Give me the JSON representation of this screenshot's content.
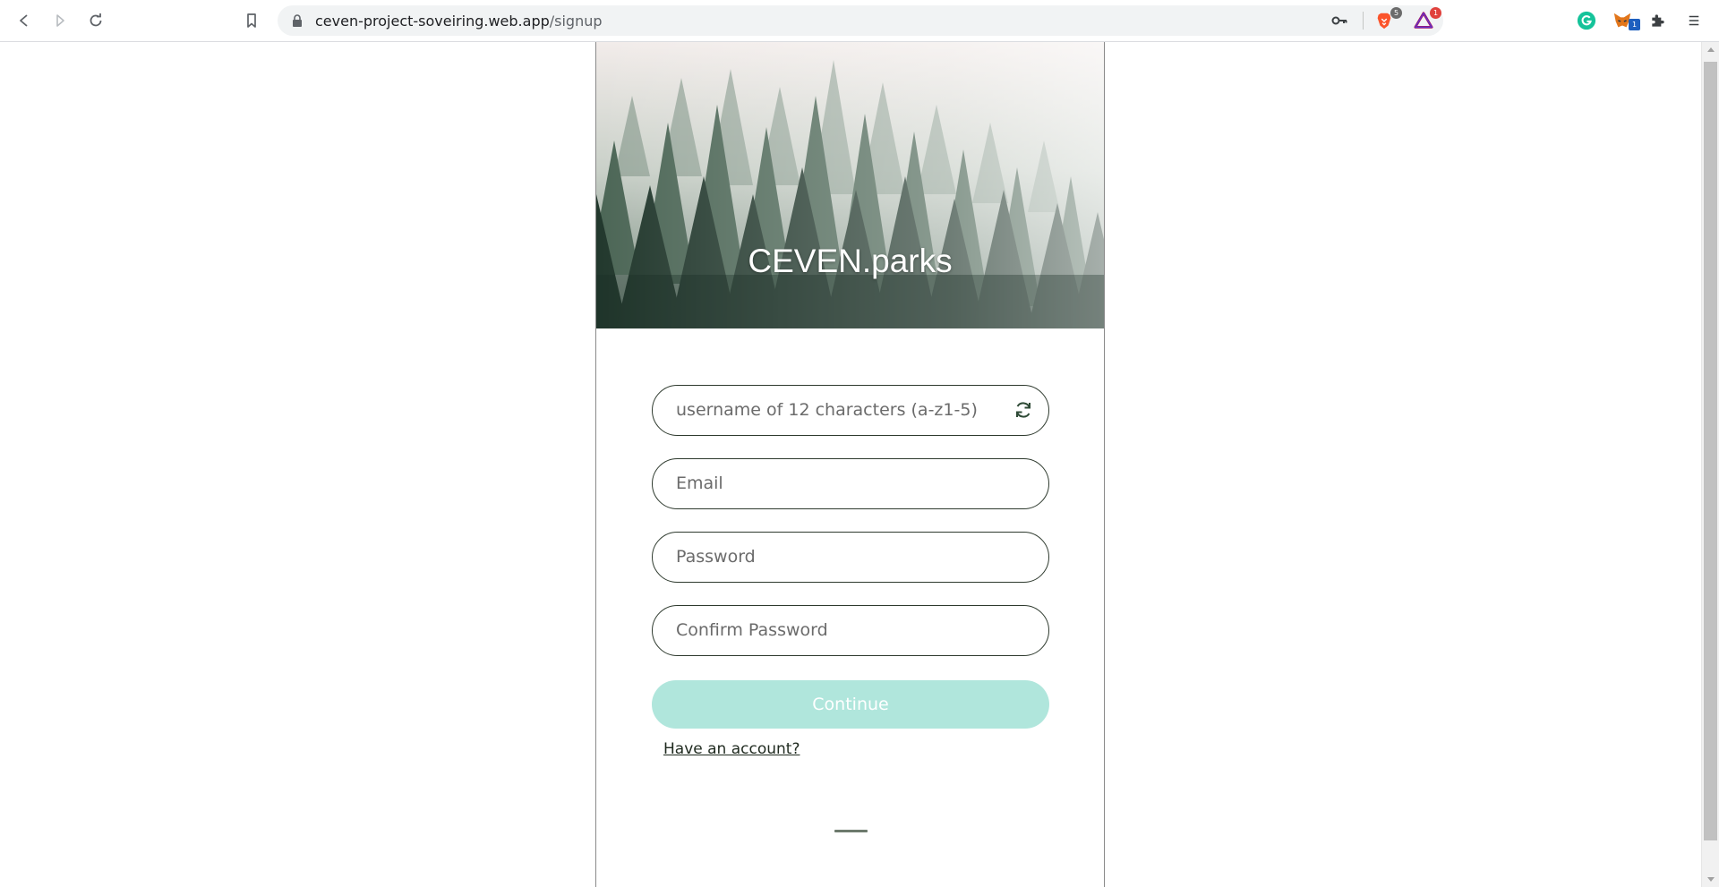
{
  "browser": {
    "url_host": "ceven-project-soveiring.web.app",
    "url_path": "/signup",
    "extensions": {
      "brave_badge": "5",
      "rewards_badge": "1",
      "metamask_badge": "1"
    }
  },
  "page": {
    "brand": "CEVEN.parks",
    "form": {
      "username_placeholder": "username of 12 characters (a-z1-5)",
      "email_placeholder": "Email",
      "password_placeholder": "Password",
      "confirm_placeholder": "Confirm Password",
      "continue_label": "Continue",
      "have_account_label": "Have an account?"
    }
  },
  "colors": {
    "accent": "#b0e6dc",
    "field_border": "#2e3a2e"
  }
}
